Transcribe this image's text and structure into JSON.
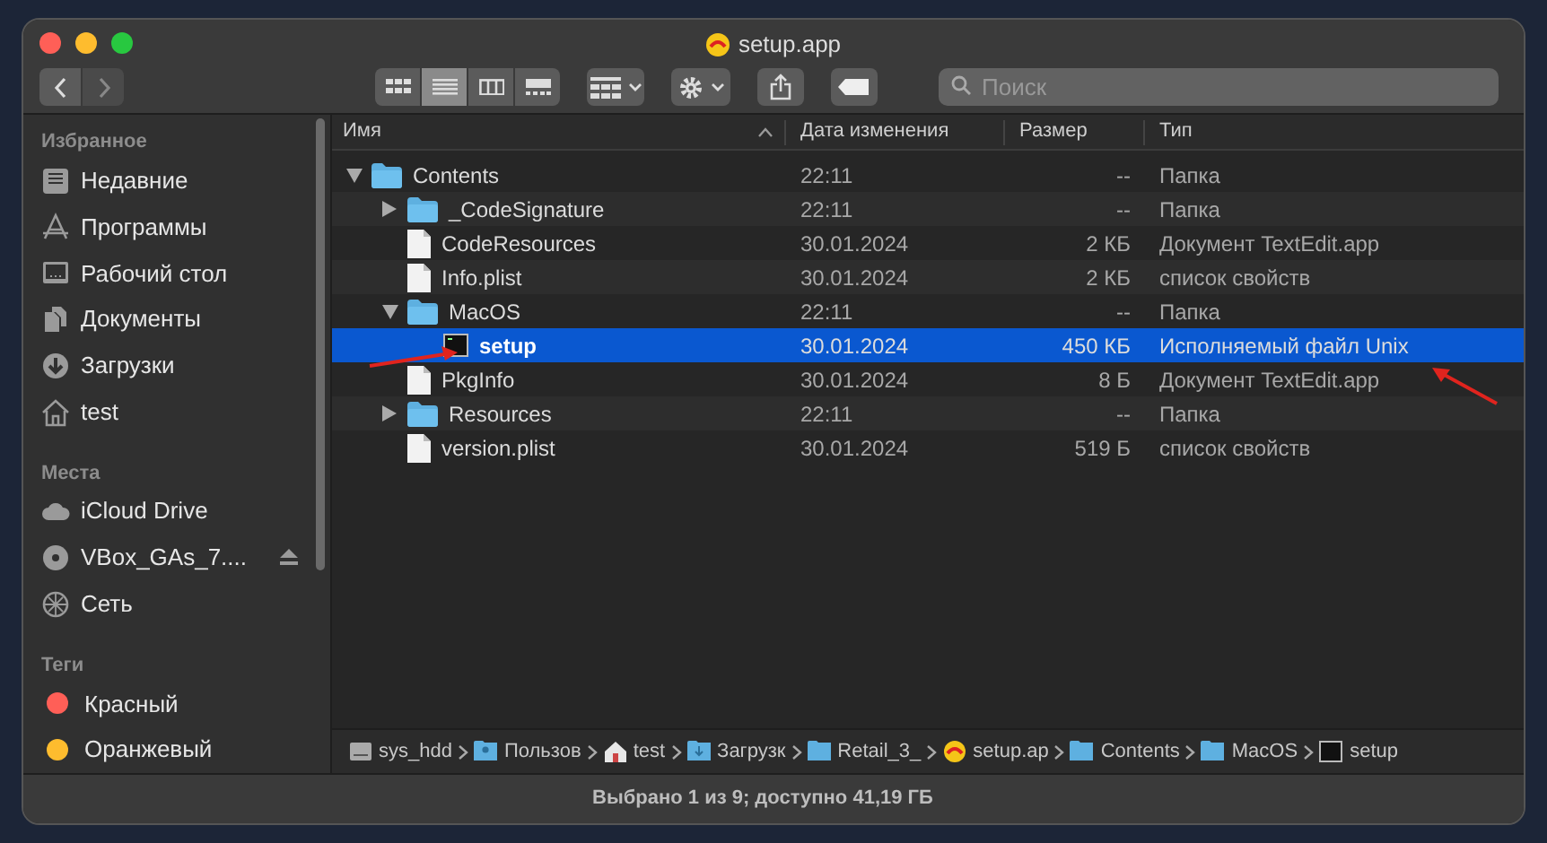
{
  "window": {
    "title": "setup.app"
  },
  "toolbar": {
    "views": [
      {
        "kind": "icons",
        "selected": false
      },
      {
        "kind": "list",
        "selected": true
      },
      {
        "kind": "columns",
        "selected": false
      },
      {
        "kind": "gallery",
        "selected": false
      }
    ],
    "search": {
      "placeholder": "Поиск"
    }
  },
  "sidebar": {
    "sections": [
      {
        "title": "Избранное",
        "items": [
          {
            "kind": "recent",
            "label": "Недавние"
          },
          {
            "kind": "apps",
            "label": "Программы"
          },
          {
            "kind": "desktop",
            "label": "Рабочий стол"
          },
          {
            "kind": "docs",
            "label": "Документы"
          },
          {
            "kind": "downloads",
            "label": "Загрузки"
          },
          {
            "kind": "home",
            "label": "test"
          }
        ]
      },
      {
        "title": "Места",
        "items": [
          {
            "kind": "cloud",
            "label": "iCloud Drive"
          },
          {
            "kind": "disc",
            "label": "VBox_GAs_7....",
            "eject": true
          },
          {
            "kind": "network",
            "label": "Сеть"
          }
        ]
      },
      {
        "title": "Теги",
        "items": [
          {
            "kind": "tag",
            "label": "Красный",
            "color": "#ff5f57"
          },
          {
            "kind": "tag",
            "label": "Оранжевый",
            "color": "#febc2e"
          }
        ]
      }
    ]
  },
  "table": {
    "columns": [
      "Имя",
      "Дата изменения",
      "Размер",
      "Тип"
    ],
    "rows": [
      {
        "kind": "folder",
        "name": "Contents",
        "date": "22:11",
        "size": "--",
        "type": "Папка",
        "expanded": true,
        "selected": false,
        "children": [
          {
            "kind": "folder",
            "name": "_CodeSignature",
            "date": "22:11",
            "size": "--",
            "type": "Папка",
            "expanded": false,
            "selected": false
          },
          {
            "kind": "file",
            "name": "CodeResources",
            "date": "30.01.2024",
            "size": "2 КБ",
            "type": "Документ TextEdit.app",
            "selected": false
          },
          {
            "kind": "file",
            "name": "Info.plist",
            "date": "30.01.2024",
            "size": "2 КБ",
            "type": "список свойств",
            "selected": false
          },
          {
            "kind": "folder",
            "name": "MacOS",
            "date": "22:11",
            "size": "--",
            "type": "Папка",
            "expanded": true,
            "selected": false,
            "children": [
              {
                "kind": "exec",
                "name": "setup",
                "date": "30.01.2024",
                "size": "450 КБ",
                "type": "Исполняемый файл Unix",
                "selected": true
              }
            ]
          },
          {
            "kind": "file",
            "name": "PkgInfo",
            "date": "30.01.2024",
            "size": "8 Б",
            "type": "Документ TextEdit.app",
            "selected": false
          },
          {
            "kind": "folder",
            "name": "Resources",
            "date": "22:11",
            "size": "--",
            "type": "Папка",
            "expanded": false,
            "selected": false
          },
          {
            "kind": "file",
            "name": "version.plist",
            "date": "30.01.2024",
            "size": "519 Б",
            "type": "список свойств",
            "selected": false
          }
        ]
      }
    ]
  },
  "path_bar": [
    {
      "kind": "disk",
      "label": "sys_hdd"
    },
    {
      "kind": "users",
      "label": "Пользов"
    },
    {
      "kind": "home",
      "label": "test"
    },
    {
      "kind": "downloads",
      "label": "Загрузк"
    },
    {
      "kind": "folder",
      "label": "Retail_3_"
    },
    {
      "kind": "app",
      "label": "setup.ap"
    },
    {
      "kind": "folder",
      "label": "Contents"
    },
    {
      "kind": "folder",
      "label": "MacOS"
    },
    {
      "kind": "exec",
      "label": "setup"
    }
  ],
  "status_bar": "Выбрано 1 из 9; доступно 41,19 ГБ"
}
